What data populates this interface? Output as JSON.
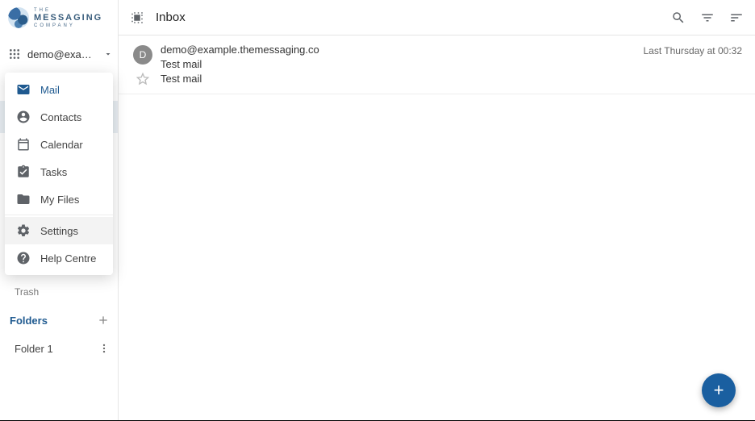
{
  "logo": {
    "line1": "THE",
    "line2": "MESSAGING",
    "line3": "COMPANY"
  },
  "account": {
    "label": "demo@exam..."
  },
  "apps_menu": {
    "mail": "Mail",
    "contacts": "Contacts",
    "calendar": "Calendar",
    "tasks": "Tasks",
    "myfiles": "My Files",
    "settings": "Settings",
    "help": "Help Centre"
  },
  "sidebar": {
    "trash": "Trash",
    "folders_title": "Folders",
    "folder1": "Folder 1"
  },
  "header": {
    "title": "Inbox"
  },
  "message": {
    "avatar_letter": "D",
    "from": "demo@example.themessaging.co",
    "subject": "Test mail",
    "preview": "Test mail",
    "time": "Last Thursday at 00:32"
  },
  "compose_label": "+"
}
